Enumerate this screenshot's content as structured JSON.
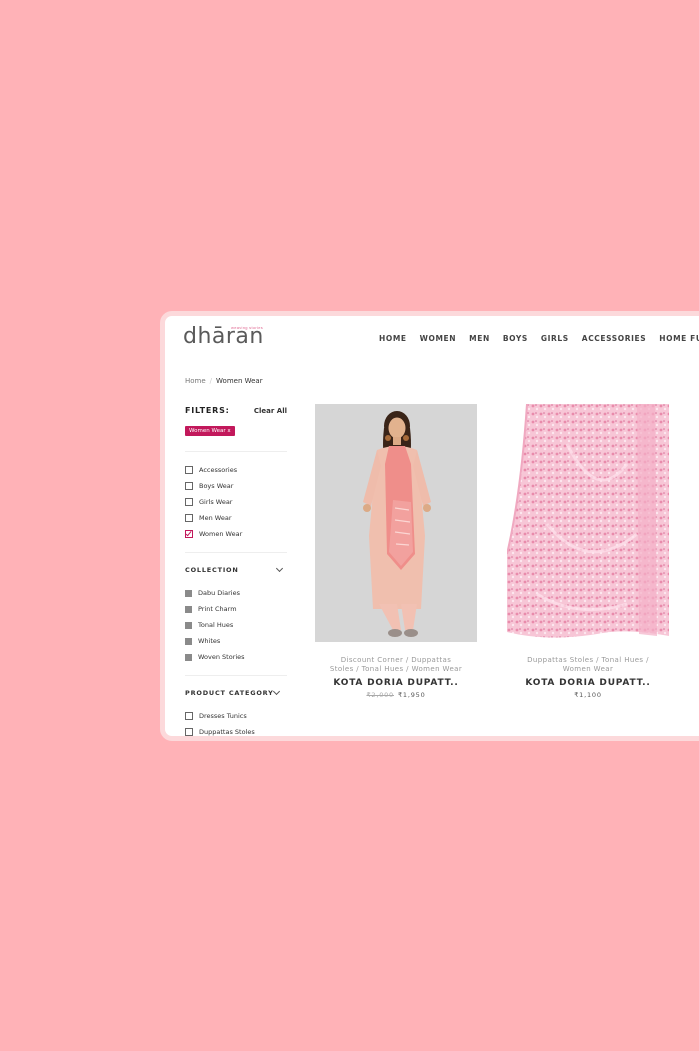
{
  "brand": {
    "logo_text": "dhāran",
    "tagline": "weaving stories"
  },
  "nav": {
    "items": [
      "HOME",
      "WOMEN",
      "MEN",
      "BOYS",
      "GIRLS",
      "ACCESSORIES",
      "HOME FURNIS"
    ]
  },
  "breadcrumb": {
    "home": "Home",
    "separator": "/",
    "current": "Women Wear"
  },
  "filters": {
    "title": "FILTERS:",
    "clear_all": "Clear All",
    "active_chip": "Women Wear  x",
    "categories": [
      {
        "label": "Accessories",
        "checked": false
      },
      {
        "label": "Boys Wear",
        "checked": false
      },
      {
        "label": "Girls Wear",
        "checked": false
      },
      {
        "label": "Men Wear",
        "checked": false
      },
      {
        "label": "Women Wear",
        "checked": true
      }
    ],
    "collection_title": "COLLECTION",
    "collections": [
      "Dabu Diaries",
      "Print Charm",
      "Tonal Hues",
      "Whites",
      "Woven Stories"
    ],
    "product_category_title": "PRODUCT CATEGORY",
    "product_categories": [
      "Dresses Tunics",
      "Duppattas Stoles"
    ]
  },
  "products": [
    {
      "categories_line1": "Discount Corner / Duppattas",
      "categories_line2": "Stoles / Tonal Hues / Women Wear",
      "name": "KOTA DORIA DUPATT..",
      "old_price": "₹2,000",
      "price": "₹1,950"
    },
    {
      "categories_line1": "Duppattas Stoles / Tonal Hues /",
      "categories_line2": "Women Wear",
      "name": "KOTA DORIA DUPATT..",
      "old_price": "",
      "price": "₹1,100"
    }
  ],
  "colors": {
    "background": "#ffb2b7",
    "accent": "#c2185b"
  }
}
